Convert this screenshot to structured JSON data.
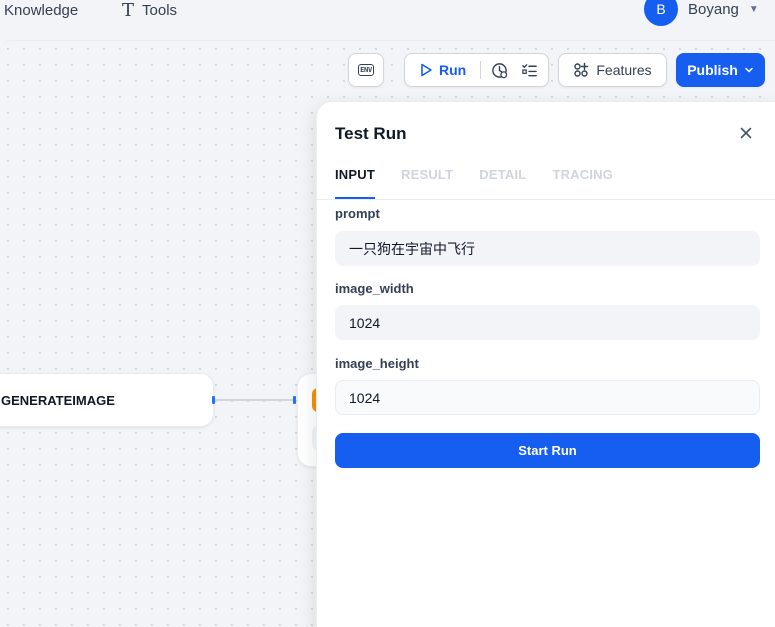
{
  "nav": {
    "knowledge": "Knowledge",
    "tools": "Tools",
    "user": {
      "initial": "B",
      "name": "Boyang"
    }
  },
  "toolbar": {
    "env": "ENV",
    "run": "Run",
    "features": "Features",
    "publish": "Publish"
  },
  "nodes": {
    "generate_image": "GENERATEIMAGE"
  },
  "panel": {
    "title": "Test Run",
    "tabs": [
      "INPUT",
      "RESULT",
      "DETAIL",
      "TRACING"
    ],
    "active_tab": "INPUT",
    "fields": [
      {
        "label": "prompt",
        "value": "一只狗在宇宙中飞行"
      },
      {
        "label": "image_width",
        "value": "1024"
      },
      {
        "label": "image_height",
        "value": "1024"
      }
    ],
    "start_button": "Start Run"
  },
  "colors": {
    "accent": "#155eef",
    "node_accent": "#f79009",
    "background": "#f2f4f7"
  }
}
